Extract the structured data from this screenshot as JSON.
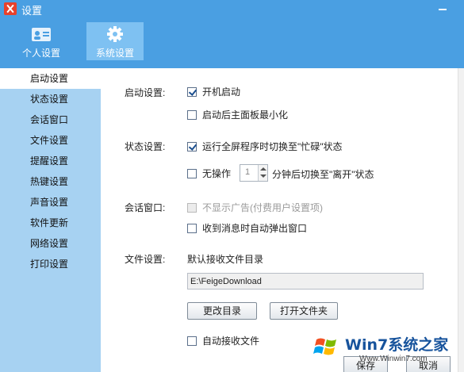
{
  "window": {
    "title": "设置"
  },
  "top_tabs": [
    {
      "label": "个人设置",
      "icon": "user-card-icon",
      "active": false
    },
    {
      "label": "系统设置",
      "icon": "gear-icon",
      "active": true
    }
  ],
  "sidebar": {
    "items": [
      {
        "label": "启动设置",
        "active": true
      },
      {
        "label": "状态设置"
      },
      {
        "label": "会话窗口"
      },
      {
        "label": "文件设置"
      },
      {
        "label": "提醒设置"
      },
      {
        "label": "热键设置"
      },
      {
        "label": "声音设置"
      },
      {
        "label": "软件更新"
      },
      {
        "label": "网络设置"
      },
      {
        "label": "打印设置"
      }
    ]
  },
  "startup": {
    "label": "启动设置:",
    "auto_start": {
      "label": "开机启动",
      "checked": true
    },
    "minimize": {
      "label": "启动后主面板最小化",
      "checked": false
    }
  },
  "status": {
    "label": "状态设置:",
    "fullscreen_busy": {
      "label": "运行全屏程序时切换至\"忙碌\"状态",
      "checked": true
    },
    "idle": {
      "label": "无操作",
      "checked": false,
      "minutes": "1",
      "suffix": "分钟后切换至\"离开\"状态"
    }
  },
  "chat": {
    "label": "会话窗口:",
    "no_ads": {
      "label": "不显示广告(付费用户设置项)",
      "checked": false,
      "disabled": true
    },
    "popup": {
      "label": "收到消息时自动弹出窗口",
      "checked": false
    }
  },
  "file": {
    "label": "文件设置:",
    "dir_label": "默认接收文件目录",
    "path": "E:\\FeigeDownload",
    "change_dir": "更改目录",
    "open_folder": "打开文件夹",
    "auto_receive": {
      "label": "自动接收文件",
      "checked": false
    }
  },
  "footer": {
    "save": "保存",
    "cancel": "取消"
  },
  "watermark": {
    "text": "Win7系统之家",
    "url": "Www.Winwin7.com"
  },
  "colors": {
    "header": "#4a9fe2",
    "sidebar": "#a7d2f2",
    "active_tab": "#7ec1f2"
  }
}
